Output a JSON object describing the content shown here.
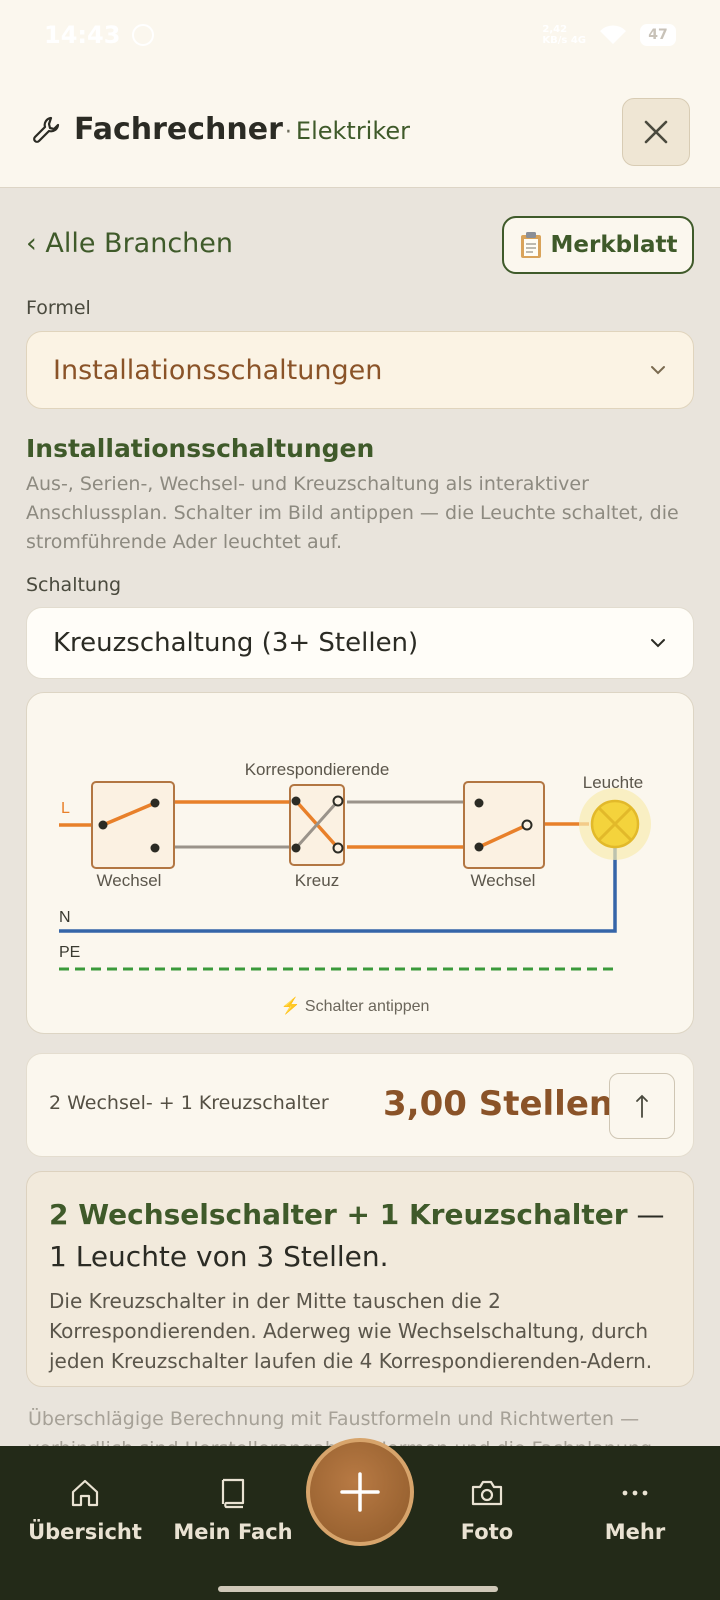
{
  "status": {
    "time": "14:43",
    "network_top": "2,42",
    "network_bottom": "KB/s 4G",
    "battery": "47"
  },
  "header": {
    "title": "Fachrechner",
    "separator": "·",
    "subtitle": "Elektriker"
  },
  "nav_back": "‹ Alle Branchen",
  "merkblatt_label": "Merkblatt",
  "formel": {
    "label": "Formel",
    "selected": "Installationsschaltungen"
  },
  "section": {
    "title": "Installationsschaltungen",
    "description": "Aus-, Serien-, Wechsel- und Kreuzschaltung als interaktiver Anschlussplan. Schalter im Bild antippen — die Leuchte schaltet, die stromführende Ader leuchtet auf."
  },
  "schaltung": {
    "label": "Schaltung",
    "selected": "Kreuzschaltung (3+ Stellen)"
  },
  "diagram": {
    "label_L": "L",
    "label_N": "N",
    "label_PE": "PE",
    "label_korrespondierende": "Korrespondierende",
    "label_leuchte": "Leuchte",
    "label_switch1": "Wechsel",
    "label_switch2": "Kreuz",
    "label_switch3": "Wechsel",
    "hint": "⚡ Schalter antippen",
    "colors": {
      "phase": "#e8802a",
      "neutral": "#3565a8",
      "pe": "#3a9a3a",
      "inactive": "#9a938a",
      "lamp": "#f4d33c",
      "switch_border": "#b27642"
    }
  },
  "result": {
    "label": "2 Wechsel- + 1 Kreuzschalter",
    "value": "3,00 Stellen"
  },
  "info": {
    "head_bold": "2 Wechselschalter + 1 Kreuzschalter",
    "head_rest": " — 1 Leuchte von 3 Stellen.",
    "body": "Die Kreuzschalter in der Mitte tauschen die 2 Korrespondierenden. Aderweg wie Wechselschaltung, durch jeden Kreuzschalter laufen die 4 Korrespondierenden-Adern."
  },
  "footnote": "Überschlägige Berechnung mit Faustformeln und Richtwerten — verbindlich sind Herstellerangaben, Normen und die Fachplanung.",
  "bottom_nav": {
    "items": [
      {
        "label": "Übersicht",
        "icon": "home-icon"
      },
      {
        "label": "Mein Fach",
        "icon": "book-icon"
      },
      {
        "label": "Foto",
        "icon": "camera-icon"
      },
      {
        "label": "Mehr",
        "icon": "more-icon"
      }
    ],
    "fab_icon": "plus-icon"
  },
  "theme": {
    "accent_green": "#3f5a2a",
    "accent_brown": "#8a5328",
    "nav_bg": "#232a18"
  }
}
